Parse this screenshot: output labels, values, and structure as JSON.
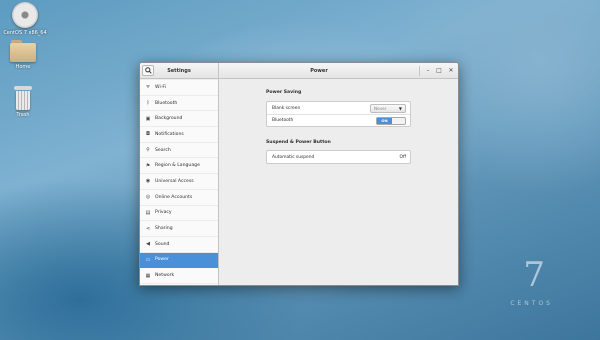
{
  "desktop": {
    "icons": [
      {
        "label": "CentOS 7 x86_64",
        "icon": "optical-disc-icon"
      },
      {
        "label": "Home",
        "icon": "folder-icon"
      },
      {
        "label": "Trash",
        "icon": "trash-icon"
      }
    ],
    "wallpaper_brand": {
      "numeral": "7",
      "name": "CENTOS"
    }
  },
  "window": {
    "left_title": "Settings",
    "right_title": "Power",
    "controls": {
      "minimize": "–",
      "maximize": "□",
      "close": "✕"
    }
  },
  "sidebar": {
    "items": [
      {
        "label": "Wi-Fi",
        "icon": "wifi-icon"
      },
      {
        "label": "Bluetooth",
        "icon": "bluetooth-icon"
      },
      {
        "label": "Background",
        "icon": "background-icon"
      },
      {
        "label": "Notifications",
        "icon": "bell-icon"
      },
      {
        "label": "Search",
        "icon": "search-icon"
      },
      {
        "label": "Region & Language",
        "icon": "region-icon"
      },
      {
        "label": "Universal Access",
        "icon": "accessibility-icon"
      },
      {
        "label": "Online Accounts",
        "icon": "accounts-icon"
      },
      {
        "label": "Privacy",
        "icon": "privacy-icon"
      },
      {
        "label": "Sharing",
        "icon": "share-icon"
      },
      {
        "label": "Sound",
        "icon": "sound-icon"
      },
      {
        "label": "Power",
        "icon": "power-icon",
        "active": true
      },
      {
        "label": "Network",
        "icon": "network-icon"
      }
    ]
  },
  "power": {
    "saving_title": "Power Saving",
    "blank_screen_label": "Blank screen",
    "blank_screen_value": "Never",
    "bluetooth_label": "Bluetooth",
    "bluetooth_state": "ON",
    "suspend_title": "Suspend & Power Button",
    "auto_suspend_label": "Automatic suspend",
    "auto_suspend_value": "Off"
  },
  "colors": {
    "accent": "#4a90d9"
  }
}
